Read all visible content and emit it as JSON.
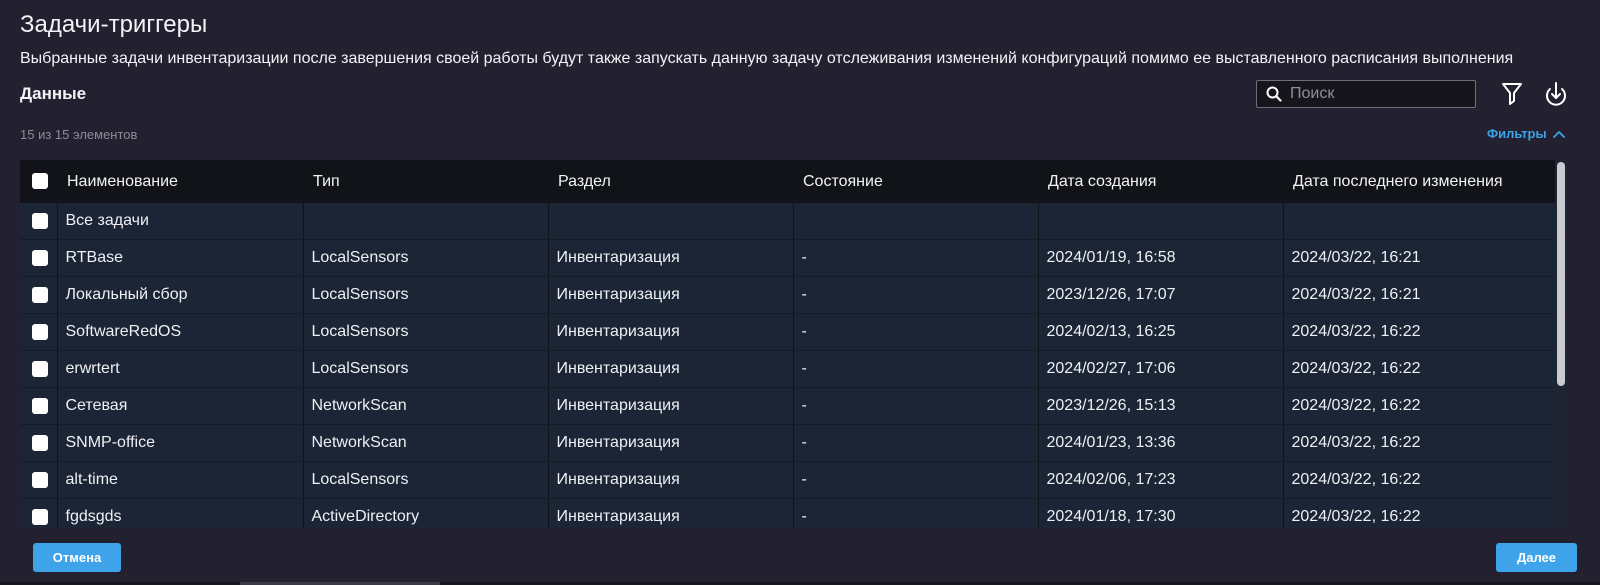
{
  "dialog": {
    "title": "Задачи-триггеры",
    "description": "Выбранные задачи инвентаризации после завершения своей работы будут также запускать данную задачу отслеживания изменений конфигураций помимо ее выставленного расписания выполнения",
    "section_title": "Данные",
    "counter": "15 из 15 элементов",
    "filters_label": "Фильтры"
  },
  "search": {
    "placeholder": "Поиск",
    "value": ""
  },
  "icons": {
    "search": "search-icon",
    "filter": "filter-icon",
    "export": "download-icon",
    "chevron": "chevron-up-icon"
  },
  "colors": {
    "background": "#232030",
    "header": "#111318",
    "row": "#1c2535",
    "accent": "#3ea3e8"
  },
  "table": {
    "columns": [
      "Наименование",
      "Тип",
      "Раздел",
      "Состояние",
      "Дата создания",
      "Дата последнего изменения"
    ],
    "rows": [
      {
        "name": "Все задачи",
        "type": "",
        "section": "",
        "state": "",
        "created": "",
        "modified": ""
      },
      {
        "name": "RTBase",
        "type": "LocalSensors",
        "section": "Инвентаризация",
        "state": "-",
        "created": "2024/01/19, 16:58",
        "modified": "2024/03/22, 16:21"
      },
      {
        "name": "Локальный сбор",
        "type": "LocalSensors",
        "section": "Инвентаризация",
        "state": "-",
        "created": "2023/12/26, 17:07",
        "modified": "2024/03/22, 16:21"
      },
      {
        "name": "SoftwareRedOS",
        "type": "LocalSensors",
        "section": "Инвентаризация",
        "state": "-",
        "created": "2024/02/13, 16:25",
        "modified": "2024/03/22, 16:22"
      },
      {
        "name": "erwrtert",
        "type": "LocalSensors",
        "section": "Инвентаризация",
        "state": "-",
        "created": "2024/02/27, 17:06",
        "modified": "2024/03/22, 16:22"
      },
      {
        "name": "Сетевая",
        "type": "NetworkScan",
        "section": "Инвентаризация",
        "state": "-",
        "created": "2023/12/26, 15:13",
        "modified": "2024/03/22, 16:22"
      },
      {
        "name": "SNMP-office",
        "type": "NetworkScan",
        "section": "Инвентаризация",
        "state": "-",
        "created": "2024/01/23, 13:36",
        "modified": "2024/03/22, 16:22"
      },
      {
        "name": "alt-time",
        "type": "LocalSensors",
        "section": "Инвентаризация",
        "state": "-",
        "created": "2024/02/06, 17:23",
        "modified": "2024/03/22, 16:22"
      },
      {
        "name": "fgdsgds",
        "type": "ActiveDirectory",
        "section": "Инвентаризация",
        "state": "-",
        "created": "2024/01/18, 17:30",
        "modified": "2024/03/22, 16:22"
      }
    ]
  },
  "footer": {
    "cancel_label": "Отмена",
    "next_label": "Далее"
  }
}
